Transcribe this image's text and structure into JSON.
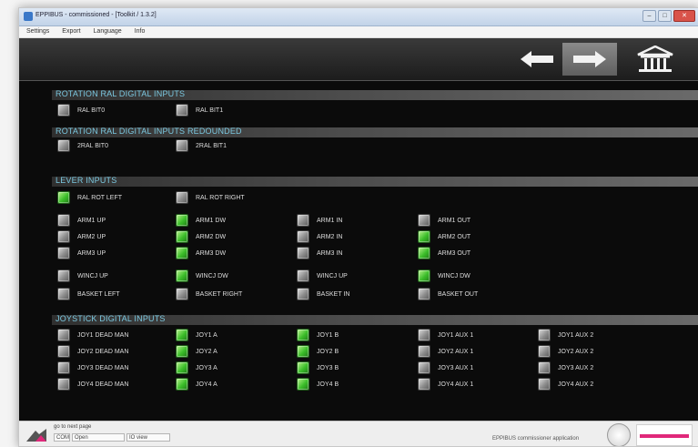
{
  "window": {
    "title": "EPPIBUS - commissioned - [Toolkit / 1.3.2]",
    "controls": {
      "minimize": "–",
      "maximize": "□",
      "close": "✕"
    }
  },
  "menu": [
    "Settings",
    "Export",
    "Language",
    "Info"
  ],
  "toolbar": {
    "back_icon": "arrow-left-icon",
    "forward_icon": "arrow-right-icon",
    "home_icon": "home-icon"
  },
  "colors": {
    "led_on": "#3cbe2a",
    "led_off": "#8c8c8c",
    "section_title": "#7bc8e0",
    "background": "#0b0b0b"
  },
  "sections": {
    "rotation": {
      "title": "ROTATION RAL DIGITAL INPUTS",
      "items": [
        {
          "label": "RAL BIT0",
          "on": false
        },
        {
          "label": "RAL BIT1",
          "on": false
        }
      ]
    },
    "rotation_redundant": {
      "title": "ROTATION RAL DIGITAL INPUTS REDOUNDED",
      "items": [
        {
          "label": "2RAL BIT0",
          "on": false
        },
        {
          "label": "2RAL BIT1",
          "on": false
        }
      ]
    },
    "lever": {
      "title": "LEVER INPUTS",
      "rows": [
        [
          {
            "label": "RAL ROT LEFT",
            "on": true
          },
          {
            "label": "RAL ROT RIGHT",
            "on": false
          }
        ],
        [
          {
            "label": "ARM1 UP",
            "on": false
          },
          {
            "label": "ARM1 DW",
            "on": true
          },
          {
            "label": "ARM1 IN",
            "on": false
          },
          {
            "label": "ARM1 OUT",
            "on": false
          }
        ],
        [
          {
            "label": "ARM2 UP",
            "on": false
          },
          {
            "label": "ARM2 DW",
            "on": true
          },
          {
            "label": "ARM2 IN",
            "on": false
          },
          {
            "label": "ARM2 OUT",
            "on": true
          }
        ],
        [
          {
            "label": "ARM3 UP",
            "on": false
          },
          {
            "label": "ARM3 DW",
            "on": true
          },
          {
            "label": "ARM3 IN",
            "on": false
          },
          {
            "label": "ARM3 OUT",
            "on": true
          }
        ],
        [
          {
            "label": "WINCJ UP",
            "on": false
          },
          {
            "label": "WINCJ DW",
            "on": true
          },
          {
            "label": "WINCJ UP",
            "on": false
          },
          {
            "label": "WINCJ DW",
            "on": true
          }
        ],
        [
          {
            "label": "BASKET LEFT",
            "on": false
          },
          {
            "label": "BASKET RIGHT",
            "on": false
          },
          {
            "label": "BASKET IN",
            "on": false
          },
          {
            "label": "BASKET OUT",
            "on": false
          }
        ]
      ]
    },
    "joystick": {
      "title": "JOYSTICK DIGITAL INPUTS",
      "rows": [
        [
          {
            "label": "JOY1 DEAD MAN",
            "on": false
          },
          {
            "label": "JOY1 A",
            "on": true
          },
          {
            "label": "JOY1 B",
            "on": true
          },
          {
            "label": "JOY1 AUX 1",
            "on": false
          },
          {
            "label": "JOY1 AUX 2",
            "on": false
          }
        ],
        [
          {
            "label": "JOY2 DEAD MAN",
            "on": false
          },
          {
            "label": "JOY2 A",
            "on": true
          },
          {
            "label": "JOY2 B",
            "on": true
          },
          {
            "label": "JOY2 AUX 1",
            "on": false
          },
          {
            "label": "JOY2 AUX 2",
            "on": false
          }
        ],
        [
          {
            "label": "JOY3 DEAD MAN",
            "on": false
          },
          {
            "label": "JOY3 A",
            "on": true
          },
          {
            "label": "JOY3 B",
            "on": true
          },
          {
            "label": "JOY3 AUX 1",
            "on": false
          },
          {
            "label": "JOY3 AUX 2",
            "on": false
          }
        ],
        [
          {
            "label": "JOY4 DEAD MAN",
            "on": false
          },
          {
            "label": "JOY4 A",
            "on": true
          },
          {
            "label": "JOY4 B",
            "on": true
          },
          {
            "label": "JOY4 AUX 1",
            "on": false
          },
          {
            "label": "JOY4 AUX 2",
            "on": false
          }
        ]
      ]
    }
  },
  "statusbar": {
    "hint": "go to next page",
    "fields": [
      "COM",
      "Open",
      "IO view"
    ],
    "center_text": "EPPIBUS commissioner application"
  }
}
